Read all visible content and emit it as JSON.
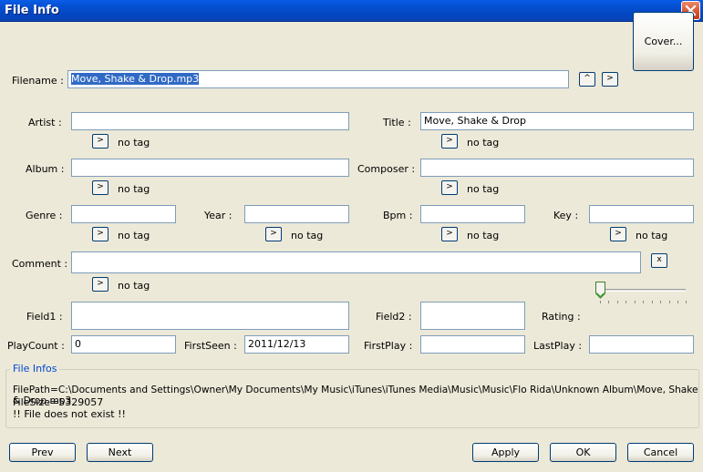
{
  "window": {
    "title": "File Info",
    "close_icon": "close-icon"
  },
  "filename": {
    "label": "Filename :",
    "value": "Move, Shake & Drop.mp3"
  },
  "cover_button": "Cover...",
  "fields": {
    "artist": {
      "label": "Artist :",
      "value": "",
      "tag": "no tag"
    },
    "title": {
      "label": "Title :",
      "value": "Move, Shake & Drop",
      "tag": "no tag"
    },
    "album": {
      "label": "Album :",
      "value": "",
      "tag": "no tag"
    },
    "composer": {
      "label": "Composer :",
      "value": "",
      "tag": "no tag"
    },
    "genre": {
      "label": "Genre :",
      "value": "",
      "tag": "no tag"
    },
    "year": {
      "label": "Year :",
      "value": "",
      "tag": "no tag"
    },
    "bpm": {
      "label": "Bpm :",
      "value": "",
      "tag": "no tag"
    },
    "key": {
      "label": "Key :",
      "value": "",
      "tag": "no tag"
    },
    "comment": {
      "label": "Comment :",
      "value": "",
      "tag": "no tag"
    },
    "field1": {
      "label": "Field1 :",
      "value": ""
    },
    "field2": {
      "label": "Field2 :",
      "value": ""
    },
    "rating": {
      "label": "Rating :",
      "value": 0,
      "max": 10
    },
    "playcount": {
      "label": "PlayCount :",
      "value": "0"
    },
    "firstseen": {
      "label": "FirstSeen :",
      "value": "2011/12/13"
    },
    "firstplay": {
      "label": "FirstPlay :",
      "value": ""
    },
    "lastplay": {
      "label": "LastPlay :",
      "value": ""
    }
  },
  "small_buttons": {
    "up": "^",
    "next": ">",
    "clear": "x"
  },
  "file_infos": {
    "title": "File Infos",
    "filepath": "FilePath=C:\\Documents and Settings\\Owner\\My Documents\\My Music\\iTunes\\iTunes Media\\Music\\Music\\Flo Rida\\Unknown Album\\Move, Shake & Drop.mp3",
    "filesize": "FileSize=5329057",
    "status": "!! File does not exist !!"
  },
  "footer": {
    "prev": "Prev",
    "next": "Next",
    "apply": "Apply",
    "ok": "OK",
    "cancel": "Cancel"
  },
  "colors": {
    "titlebar": "#0450d2",
    "face": "#ece9d8",
    "selection": "#316ac5",
    "group_title": "#0046d5"
  }
}
